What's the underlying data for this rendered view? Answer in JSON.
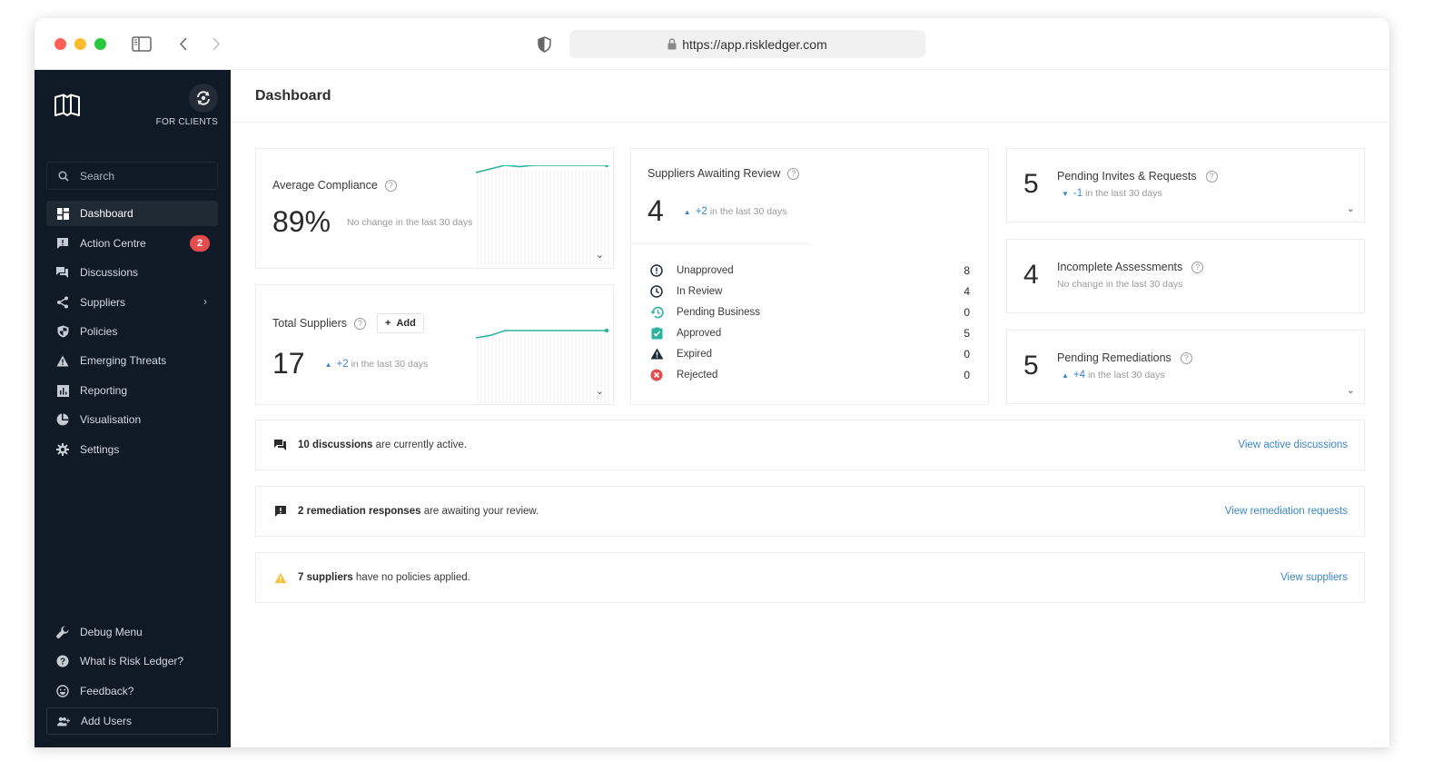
{
  "browser": {
    "url": "https://app.riskledger.com"
  },
  "sidebar": {
    "for_clients_label": "FOR CLIENTS",
    "search_placeholder": "Search",
    "items": [
      {
        "label": "Dashboard",
        "icon": "dashboard-icon",
        "active": true
      },
      {
        "label": "Action Centre",
        "icon": "alert-message-icon",
        "badge": "2"
      },
      {
        "label": "Discussions",
        "icon": "discussions-icon"
      },
      {
        "label": "Suppliers",
        "icon": "share-icon",
        "has_submenu": true
      },
      {
        "label": "Policies",
        "icon": "shield-icon"
      },
      {
        "label": "Emerging Threats",
        "icon": "warning-icon"
      },
      {
        "label": "Reporting",
        "icon": "bar-chart-icon"
      },
      {
        "label": "Visualisation",
        "icon": "pie-chart-icon"
      },
      {
        "label": "Settings",
        "icon": "gear-icon"
      }
    ],
    "bottom_items": [
      {
        "label": "Debug Menu",
        "icon": "wrench-icon"
      },
      {
        "label": "What is Risk Ledger?",
        "icon": "help-circle-icon"
      },
      {
        "label": "Feedback?",
        "icon": "smiley-icon"
      },
      {
        "label": "Add Users",
        "icon": "add-users-icon"
      }
    ]
  },
  "header": {
    "title": "Dashboard"
  },
  "cards": {
    "average_compliance": {
      "title": "Average Compliance",
      "value": "89%",
      "change_text": "No change in the last 30 days",
      "trend": [
        88,
        88.5,
        89,
        88.8,
        89,
        89,
        89,
        89,
        89,
        89
      ]
    },
    "total_suppliers": {
      "title": "Total Suppliers",
      "add_label": "Add",
      "value": "17",
      "delta": "+2",
      "change_suffix": "in the last 30 days",
      "trend": [
        14,
        15,
        17,
        17,
        17,
        17,
        17,
        17,
        17,
        17
      ]
    },
    "suppliers_awaiting_review": {
      "title": "Suppliers Awaiting Review",
      "value": "4",
      "delta": "+2",
      "change_suffix": "in the last 30 days",
      "statuses": [
        {
          "label": "Unapproved",
          "count": "8",
          "icon": "exclamation-circle-icon",
          "color": "#1c2a3a"
        },
        {
          "label": "In Review",
          "count": "4",
          "icon": "clock-icon",
          "color": "#1c2a3a"
        },
        {
          "label": "Pending Business",
          "count": "0",
          "icon": "history-icon",
          "color": "#2bb3a0"
        },
        {
          "label": "Approved",
          "count": "5",
          "icon": "clipboard-check-icon",
          "color": "#2bb3a0"
        },
        {
          "label": "Expired",
          "count": "0",
          "icon": "warning-triangle-icon",
          "color": "#1c2a3a"
        },
        {
          "label": "Rejected",
          "count": "0",
          "icon": "x-circle-icon",
          "color": "#e44d4d"
        }
      ]
    },
    "pending_invites": {
      "title": "Pending Invites & Requests",
      "value": "5",
      "delta": "-1",
      "change_suffix": "in the last 30 days"
    },
    "incomplete_assessments": {
      "title": "Incomplete Assessments",
      "value": "4",
      "change_text": "No change in the last 30 days"
    },
    "pending_remediations": {
      "title": "Pending Remediations",
      "value": "5",
      "delta": "+4",
      "change_suffix": "in the last 30 days"
    }
  },
  "notices": [
    {
      "bold": "10 discussions",
      "text": " are currently active.",
      "link": "View active discussions",
      "icon": "discussions-icon"
    },
    {
      "bold": "2 remediation responses",
      "text": " are awaiting your review.",
      "link": "View remediation requests",
      "icon": "alert-message-icon"
    },
    {
      "bold": "7 suppliers",
      "text": " have no policies applied.",
      "link": "View suppliers",
      "icon": "warning-icon"
    }
  ],
  "colors": {
    "sidebar_bg": "#101a26",
    "accent_teal": "#2bb3a0",
    "link_blue": "#3a85c8",
    "badge_red": "#e44d4d",
    "warning_yellow": "#f2c23c"
  }
}
